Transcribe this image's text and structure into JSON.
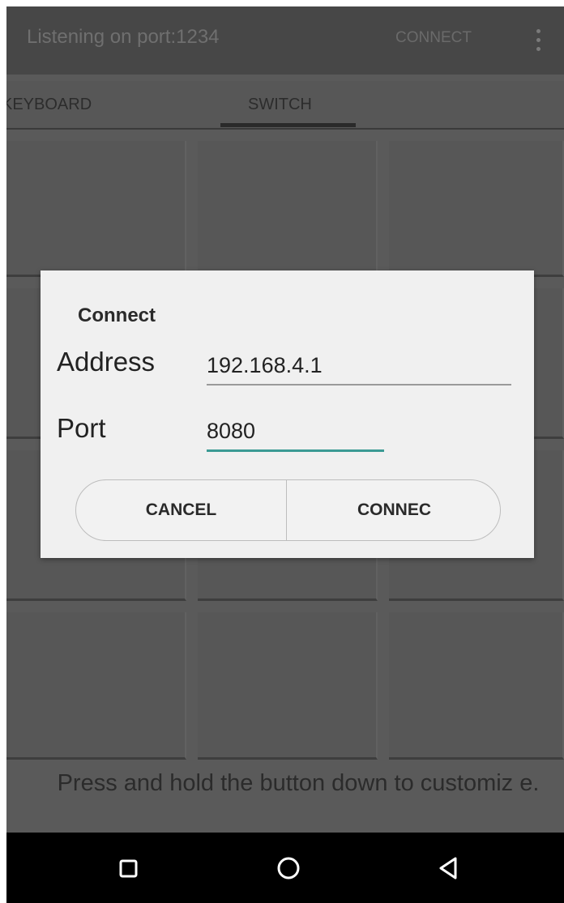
{
  "app": {
    "title": "Listening on port:1234",
    "connect_action": "CONNECT",
    "overflow_icon": "more-vert-icon"
  },
  "tabs": [
    {
      "label": "KEYBOARD",
      "selected": false
    },
    {
      "label": "SWITCH",
      "selected": true
    }
  ],
  "hint": "Press and hold the button down to customiz e.",
  "dialog": {
    "title": "Connect",
    "address_label": "Address",
    "address_value": "192.168.4.1",
    "port_label": "Port",
    "port_value": "8080",
    "cancel_label": "CANCEL",
    "connect_label": "CONNEC"
  },
  "nav": {
    "recents_icon": "recents-square-icon",
    "home_icon": "home-circle-icon",
    "back_icon": "back-triangle-icon"
  },
  "colors": {
    "accent": "#3a9a94",
    "scrim_bg": "#5a5a5a",
    "dialog_bg": "#f0f0f0",
    "nav_bg": "#000000"
  }
}
